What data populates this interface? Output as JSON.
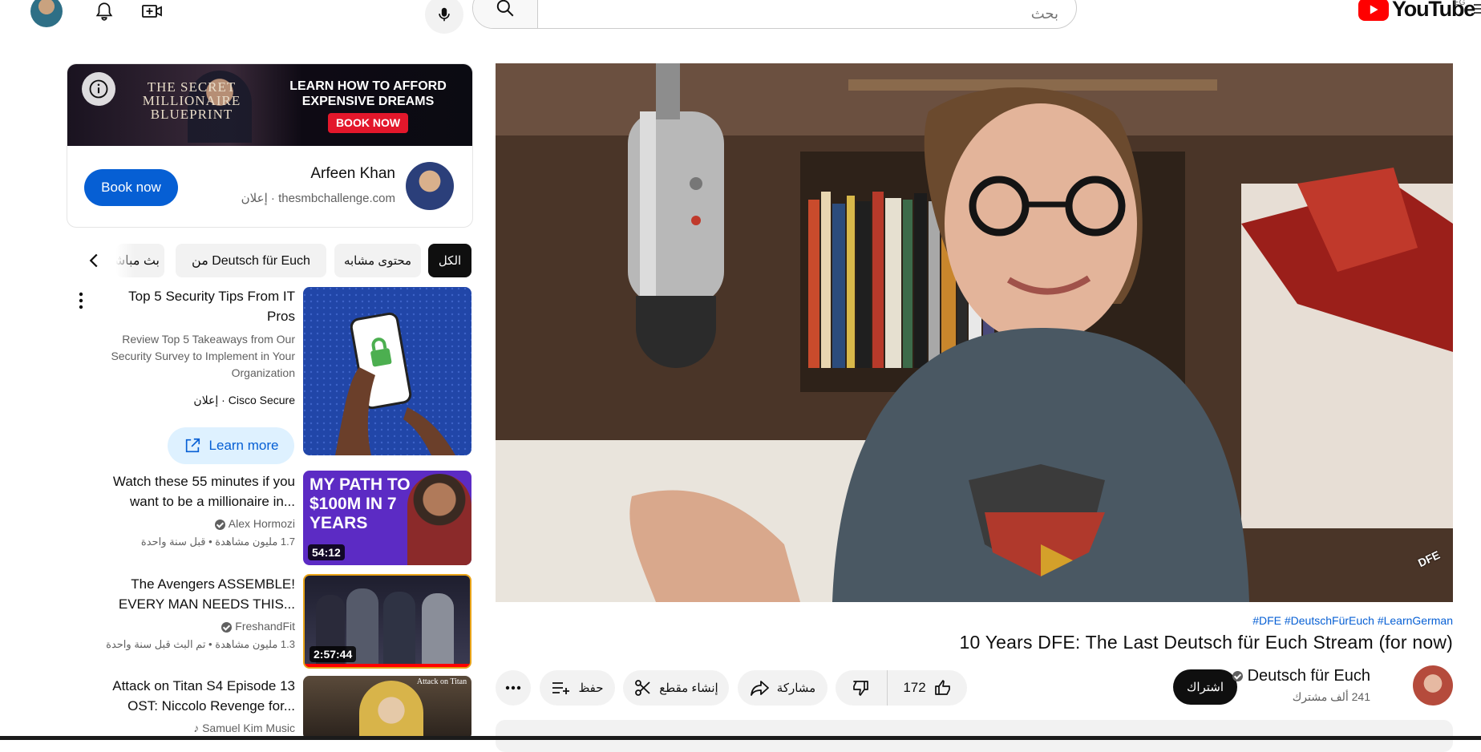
{
  "header": {
    "search_placeholder": "بحث",
    "logo_text": "YouTube",
    "region": "EG"
  },
  "ad": {
    "banner_left": "THE SECRET MILLIONAIRE BLUEPRINT",
    "banner_headline": "LEARN HOW TO AFFORD EXPENSIVE DREAMS",
    "banner_cta": "BOOK NOW",
    "advertiser": "Arfeen Khan",
    "sub": "thesmbchallenge.com · إعلان",
    "button": "Book now"
  },
  "chips": [
    "الكل",
    "محتوى مشابه",
    "من Deutsch für Euch",
    "بث مباشر"
  ],
  "sidebar": {
    "ad_video": {
      "title": "Top 5 Security Tips From IT Pros",
      "desc": "Review Top 5 Takeaways from Our Security Survey to Implement in Your Organization",
      "sponsor": "Cisco Secure · إعلان",
      "cta": "Learn more"
    },
    "videos": [
      {
        "title": "Watch these 55 minutes if you want to be a millionaire in...",
        "channel": "Alex Hormozi",
        "meta": "1.7 مليون مشاهدة • قبل سنة واحدة",
        "duration": "54:12",
        "thumb_text": "MY PATH TO $100M IN 7 YEARS"
      },
      {
        "title": "The Avengers ASSEMBLE! EVERY MAN NEEDS THIS...",
        "channel": "FreshandFit",
        "meta": "1.3 مليون مشاهدة • تم البث قبل سنة واحدة",
        "duration": "2:57:44"
      },
      {
        "title": "Attack on Titan S4 Episode 13 OST: Niccolo Revenge for...",
        "channel": "Samuel Kim Music",
        "thumb_text": "Attack on Titan"
      }
    ]
  },
  "video": {
    "hashtags": "#DFE #DeutschFürEuch #LearnGerman",
    "title": "10 Years DFE: The Last Deutsch für Euch Stream (for now)",
    "channel": "Deutsch für Euch",
    "subscribers": "241 ألف مشترك",
    "subscribe": "اشتراك",
    "likes": "172",
    "share": "مشاركة",
    "clip": "إنشاء مقطع",
    "save": "حفظ",
    "watermark": "DFE"
  },
  "colors": {
    "accent": "#065fd4",
    "brand": "#ff0000",
    "chip_bg": "#f2f2f2"
  }
}
